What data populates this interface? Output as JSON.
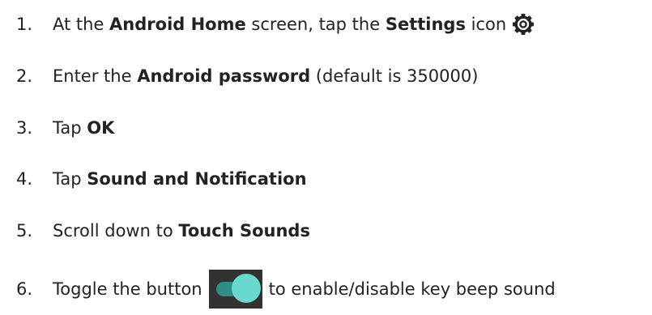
{
  "steps": [
    {
      "number": "1.",
      "parts": [
        "At the ",
        "Android Home",
        " screen, tap the ",
        "Settings",
        " icon"
      ],
      "icon": "settings-gear-icon"
    },
    {
      "number": "2.",
      "parts": [
        "Enter the ",
        "Android password",
        " (default is 350000)"
      ]
    },
    {
      "number": "3.",
      "parts": [
        "Tap ",
        "OK"
      ]
    },
    {
      "number": "4.",
      "parts": [
        "Tap ",
        "Sound and Notification"
      ]
    },
    {
      "number": "5.",
      "parts": [
        "Scroll down to ",
        "Touch Sounds"
      ]
    },
    {
      "number": "6.",
      "parts": [
        "Toggle the button",
        "to enable/disable key beep sound"
      ],
      "icon": "toggle-switch-icon"
    }
  ],
  "colors": {
    "text": "#222222",
    "toggle_track": "#323232",
    "toggle_rail": "#2e8d84",
    "toggle_knob": "#69d9cd"
  }
}
